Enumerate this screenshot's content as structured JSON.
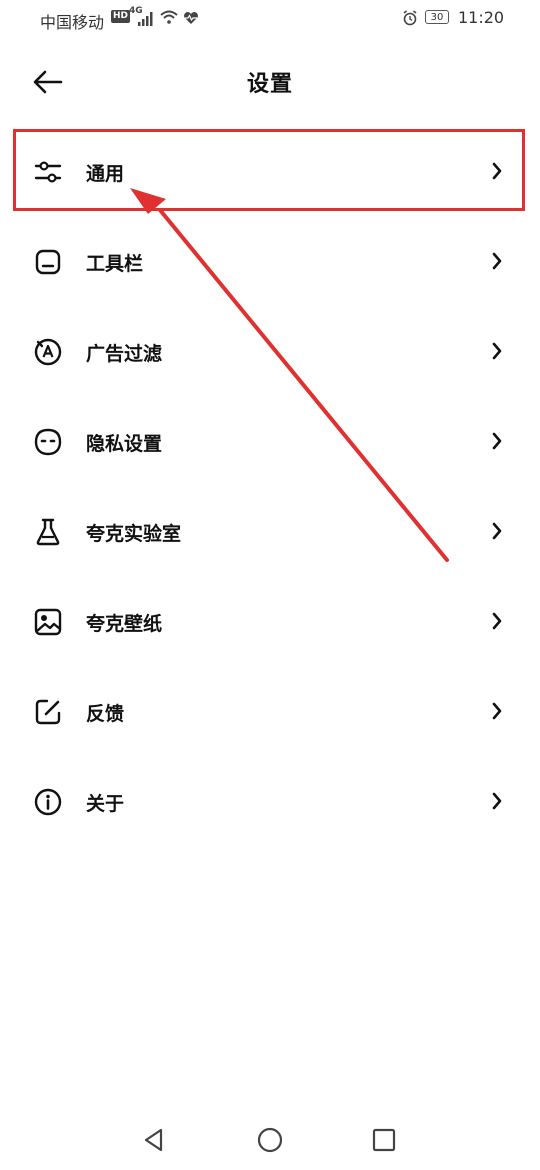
{
  "status_bar": {
    "carrier": "中国移动",
    "hd_badge": "HD",
    "network": "4G",
    "battery": "30",
    "time": "11:20"
  },
  "header": {
    "title": "设置",
    "back_icon": "arrow-left-icon"
  },
  "menu": {
    "items": [
      {
        "label": "通用",
        "icon": "sliders-icon"
      },
      {
        "label": "工具栏",
        "icon": "toolbar-icon"
      },
      {
        "label": "广告过滤",
        "icon": "ad-block-icon"
      },
      {
        "label": "隐私设置",
        "icon": "privacy-face-icon"
      },
      {
        "label": "夸克实验室",
        "icon": "flask-icon"
      },
      {
        "label": "夸克壁纸",
        "icon": "wallpaper-image-icon"
      },
      {
        "label": "反馈",
        "icon": "feedback-edit-icon"
      },
      {
        "label": "关于",
        "icon": "info-icon"
      }
    ]
  },
  "annotation": {
    "color": "#e03030",
    "highlighted_item": "通用"
  },
  "nav_bar": {
    "back": "triangle-back-icon",
    "home": "circle-home-icon",
    "recents": "square-recents-icon"
  }
}
